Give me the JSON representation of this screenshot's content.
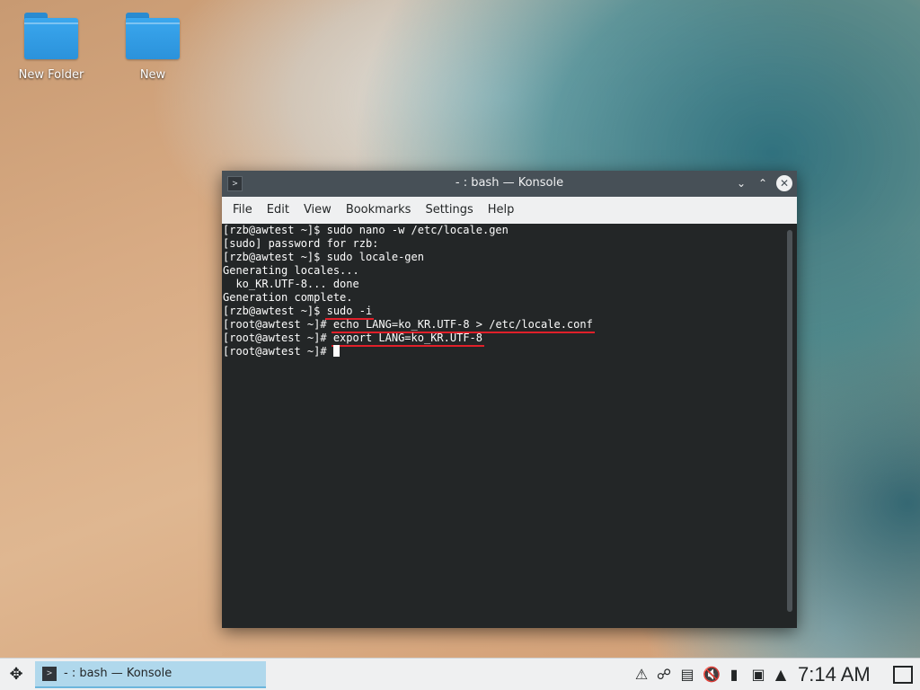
{
  "desktop": {
    "icons": [
      {
        "label": "New Folder"
      },
      {
        "label": "New"
      }
    ]
  },
  "window": {
    "title": "- : bash — Konsole",
    "app_icon": "terminal-icon",
    "menu": [
      "File",
      "Edit",
      "View",
      "Bookmarks",
      "Settings",
      "Help"
    ]
  },
  "terminal": {
    "lines": [
      {
        "text": "[rzb@awtest ~]$ sudo nano -w /etc/locale.gen"
      },
      {
        "text": "[sudo] password for rzb:"
      },
      {
        "text": "[rzb@awtest ~]$ sudo locale-gen"
      },
      {
        "text": "Generating locales..."
      },
      {
        "text": "  ko_KR.UTF-8... done"
      },
      {
        "text": "Generation complete."
      },
      {
        "prompt": "[rzb@awtest ~]$ ",
        "command": "sudo -i",
        "underlined": true
      },
      {
        "prompt": "[root@awtest ~]# ",
        "command": "echo LANG=ko_KR.UTF-8 > /etc/locale.conf",
        "underlined": true
      },
      {
        "prompt": "[root@awtest ~]# ",
        "command": "export LANG=ko_KR.UTF-8",
        "underlined": true
      },
      {
        "prompt": "[root@awtest ~]# ",
        "command": "",
        "cursor": true
      }
    ],
    "underline_color": "#e0202a"
  },
  "taskbar": {
    "task_label": "- : bash — Konsole",
    "clock": "7:14 AM",
    "tray_icons": [
      "notifications-icon",
      "network-icon",
      "clipboard-icon",
      "volume-muted-icon",
      "usb-device-icon",
      "display-icon",
      "expand-tray-icon"
    ]
  },
  "colors": {
    "titlebar": "#475057",
    "terminal_bg": "#232627",
    "task_highlight": "#b0d8ec",
    "folder": "#3aa7ee"
  }
}
